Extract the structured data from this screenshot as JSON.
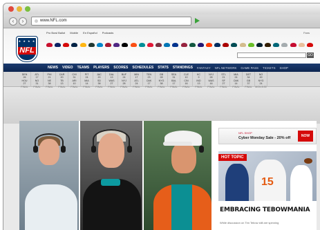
{
  "browser": {
    "url": "www.NFL.com",
    "nav_back": "‹",
    "nav_fwd": "›"
  },
  "utility_links": [
    "Pro Bowl Ballot",
    "Mobile",
    "En Español",
    "Podcasts"
  ],
  "fans_label": "Fans",
  "logo": {
    "stars": "★ ★ ★ ★",
    "word": "NFL"
  },
  "team_colors": [
    "#c8102e",
    "#0b2265",
    "#d50a0a",
    "#002244",
    "#ffb612",
    "#203731",
    "#0085ca",
    "#a71930",
    "#4f2683",
    "#000000",
    "#fb4f14",
    "#008e97",
    "#e31837",
    "#773141",
    "#0076b6",
    "#00338d",
    "#97233f",
    "#125740",
    "#241773",
    "#ff3c00",
    "#002c5f",
    "#aa0000",
    "#004c54",
    "#d3bc8d",
    "#69be28",
    "#03202f",
    "#311d00",
    "#006778",
    "#a5acaf",
    "#c60c30",
    "#e9bf9b",
    "#d50a0a"
  ],
  "search_button": "GO",
  "main_nav": [
    "NEWS",
    "VIDEO",
    "TEAMS",
    "PLAYERS",
    "SCORES",
    "SCHEDULES",
    "STATS",
    "STANDINGS"
  ],
  "main_nav_secondary": [
    "FANTASY",
    "NFL NETWORK",
    "GAME PASS",
    "TICKETS",
    "SHOP"
  ],
  "scores": [
    {
      "a": "DEN",
      "sa": "26",
      "h": "HOU",
      "sh": "27",
      "st": "FINAL"
    },
    {
      "a": "ATL",
      "sa": "17",
      "h": "NO",
      "sh": "31",
      "st": "FINAL"
    },
    {
      "a": "PHI",
      "sa": "21",
      "h": "NE",
      "sh": "38",
      "st": "FINAL"
    },
    {
      "a": "CAR",
      "sa": "20",
      "h": "TB",
      "sh": "13",
      "st": "FINAL"
    },
    {
      "a": "CHI",
      "sa": "31",
      "h": "ARI",
      "sh": "10",
      "st": "FINAL"
    },
    {
      "a": "PIT",
      "sa": "24",
      "h": "MIA",
      "sh": "14",
      "st": "FINAL"
    },
    {
      "a": "JAC",
      "sa": "20",
      "h": "SD",
      "sh": "38",
      "st": "FINAL"
    },
    {
      "a": "DAL",
      "sa": "13",
      "h": "WAS",
      "sh": "27",
      "st": "FINAL"
    },
    {
      "a": "BUF",
      "sa": "24",
      "h": "NYJ",
      "sh": "28",
      "st": "FINAL"
    },
    {
      "a": "MIN",
      "sa": "17",
      "h": "ATL",
      "sh": "24",
      "st": "FINAL"
    },
    {
      "a": "TEN",
      "sa": "23",
      "h": "OAK",
      "sh": "17",
      "st": "FINAL"
    },
    {
      "a": "GB",
      "sa": "28",
      "h": "NYG",
      "sh": "38",
      "st": "FINAL"
    },
    {
      "a": "SEA",
      "sa": "31",
      "h": "BAL",
      "sh": "17",
      "st": "FINAL"
    },
    {
      "a": "CLE",
      "sa": "10",
      "h": "CIN",
      "sh": "16",
      "st": "FINAL"
    },
    {
      "a": "KC",
      "sa": "9",
      "h": "IND",
      "sh": "13",
      "st": "FINAL"
    },
    {
      "a": "NYJ",
      "sa": "28",
      "h": "WAS",
      "sh": "16",
      "st": "FINAL"
    },
    {
      "a": "STL",
      "sa": "21",
      "h": "SF",
      "sh": "27",
      "st": "FINAL"
    },
    {
      "a": "MIA",
      "sa": "24",
      "h": "OAK",
      "sh": "14",
      "st": "FINAL"
    },
    {
      "a": "DET",
      "sa": "34",
      "h": "GB",
      "sh": "37",
      "st": "FINAL"
    },
    {
      "a": "NO",
      "sa": "49",
      "h": "NYG",
      "sh": "24",
      "st": "MON 8:30"
    }
  ],
  "ad": {
    "shop_label": "NFL SHOP",
    "text": "Cyber Monday Sale - 20% off",
    "button": "NOW"
  },
  "hot_topic": {
    "badge": "HOT TOPIC",
    "jersey_number": "15",
    "headline": "EMBRACING TEBOWMANIA",
    "sub": "While discussion on Tim Tebow still are spinning"
  }
}
